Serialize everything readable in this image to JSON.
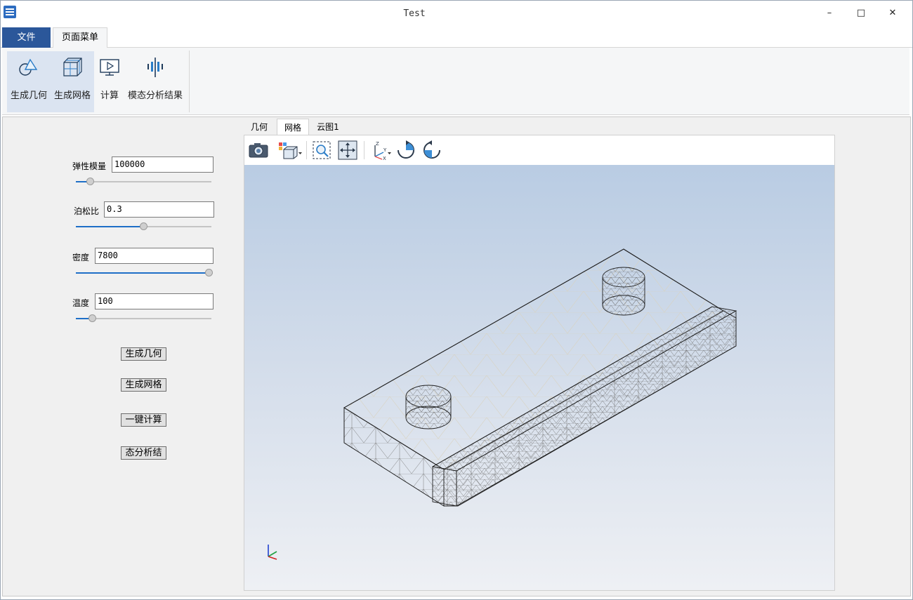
{
  "window": {
    "title": "Test",
    "minimize": "–",
    "maximize": "□",
    "close": "✕"
  },
  "menu_tabs": {
    "file": "文件",
    "page_menu": "页面菜单"
  },
  "ribbon": {
    "items": [
      {
        "label": "生成几何",
        "icon": "geometry-icon"
      },
      {
        "label": "生成网格",
        "icon": "mesh-cube-icon"
      },
      {
        "label": "计算",
        "icon": "compute-monitor-icon"
      },
      {
        "label": "模态分析结果",
        "icon": "modal-result-icon"
      }
    ]
  },
  "params": {
    "elastic_modulus": {
      "label": "弹性模量",
      "value": "100000",
      "level": 0.08
    },
    "poisson_ratio": {
      "label": "泊松比",
      "value": "0.3",
      "level": 0.5
    },
    "density": {
      "label": "密度",
      "value": "7800",
      "level": 1.0
    },
    "temperature": {
      "label": "温度",
      "value": "100",
      "level": 0.1
    }
  },
  "actions": {
    "gen_geometry": "生成几何",
    "gen_mesh": "生成网格",
    "one_click_compute": "一键计算",
    "modal_result": "态分析结"
  },
  "viewer": {
    "tabs": [
      "几何",
      "网格",
      "云图1"
    ],
    "active_tab": "网格",
    "toolbar_icons": [
      "camera-icon",
      "display-mode-icon",
      "zoom-box-icon",
      "fit-view-icon",
      "axes-orientation-icon",
      "rotate-cw-icon",
      "rotate-ccw-icon"
    ],
    "background_top": "#b9cce3",
    "background_bottom": "#eef0f4"
  },
  "accent": "#2b579a"
}
